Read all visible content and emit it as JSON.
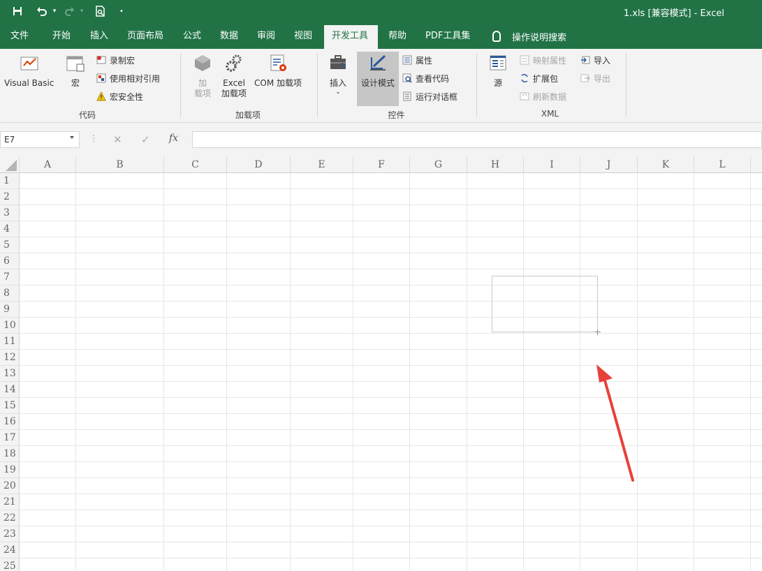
{
  "window": {
    "title": "1.xls  [兼容模式]  -  Excel"
  },
  "ribbon_tabs": [
    {
      "label": "文件"
    },
    {
      "label": "开始"
    },
    {
      "label": "插入"
    },
    {
      "label": "页面布局"
    },
    {
      "label": "公式"
    },
    {
      "label": "数据"
    },
    {
      "label": "审阅"
    },
    {
      "label": "视图"
    },
    {
      "label": "开发工具",
      "active": true
    },
    {
      "label": "帮助"
    },
    {
      "label": "PDF工具集"
    }
  ],
  "tell_me": "操作说明搜索",
  "ribbon": {
    "code_group": {
      "label": "代码",
      "visual_basic": "Visual Basic",
      "macros": "宏",
      "record_macro": "录制宏",
      "relative_refs": "使用相对引用",
      "macro_security": "宏安全性"
    },
    "addins_group": {
      "label": "加载项",
      "addins_line1": "加",
      "addins_line2": "载项",
      "excel_addins_line1": "Excel",
      "excel_addins_line2": "加载项",
      "com_addins": "COM 加载项"
    },
    "controls_group": {
      "label": "控件",
      "insert": "插入",
      "insert_dropdown": "⌄",
      "design_mode": "设计模式",
      "properties": "属性",
      "view_code": "查看代码",
      "run_dialog": "运行对话框"
    },
    "xml_group": {
      "label": "XML",
      "source": "源",
      "map_properties": "映射属性",
      "expansion_packs": "扩展包",
      "refresh_data": "刷新数据",
      "import": "导入",
      "export": "导出"
    }
  },
  "formula_bar": {
    "name_box": "E7",
    "fx": "fx",
    "cancel": "✕",
    "enter": "✓",
    "value": ""
  },
  "columns": [
    "A",
    "B",
    "C",
    "D",
    "E",
    "F",
    "G",
    "H",
    "I",
    "J",
    "K",
    "L"
  ],
  "rows": [
    "1",
    "2",
    "3",
    "4",
    "5",
    "6",
    "7",
    "8",
    "9",
    "10",
    "11",
    "12",
    "13",
    "14",
    "15",
    "16",
    "17",
    "18",
    "19",
    "20",
    "21",
    "22",
    "23",
    "24",
    "25"
  ],
  "colors": {
    "excel_green": "#217346",
    "ribbon_bg": "#f3f3f3",
    "annotation_arrow": "#e8413a"
  }
}
